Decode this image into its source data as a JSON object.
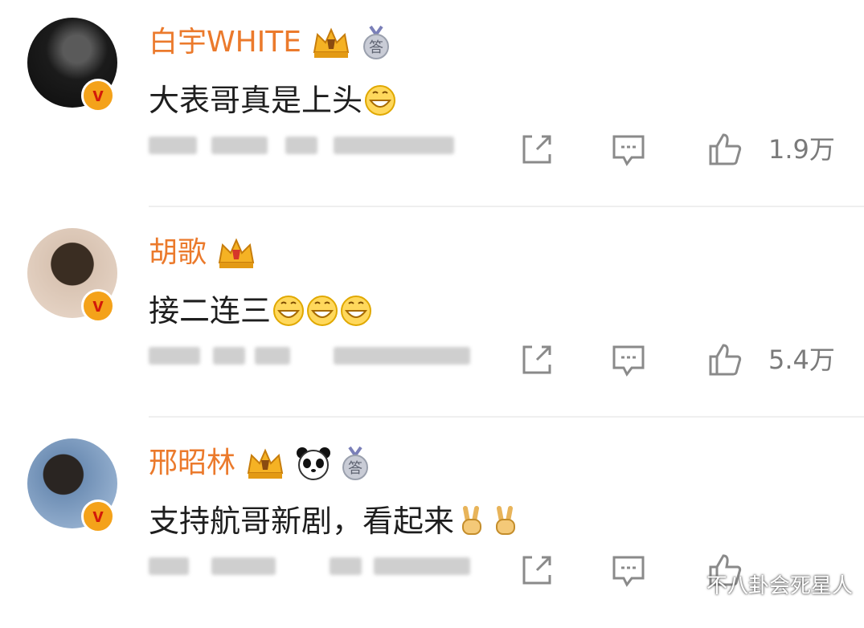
{
  "comments": [
    {
      "username": "白宇WHITE",
      "text": "大表哥真是上头",
      "emojis": [
        "grin-emoji"
      ],
      "badges": [
        "crown-badge-icon",
        "medal-answer-icon"
      ],
      "medal_char": "答",
      "likes": "1.9万",
      "verified_mark": "v"
    },
    {
      "username": "胡歌",
      "text": "接二连三",
      "emojis": [
        "grin-emoji",
        "grin-emoji",
        "grin-emoji"
      ],
      "badges": [
        "crown-badge-icon"
      ],
      "likes": "5.4万",
      "verified_mark": "v"
    },
    {
      "username": "邢昭林",
      "text": "支持航哥新剧，看起来",
      "emojis": [
        "victory-hand-emoji",
        "victory-hand-emoji"
      ],
      "badges": [
        "crown-badge-icon",
        "panda-icon",
        "medal-answer-icon"
      ],
      "medal_char": "答",
      "likes": "",
      "verified_mark": "v"
    }
  ],
  "watermark": "不八卦会死星人",
  "colors": {
    "username": "#eb7a2c",
    "verified_badge": "#f4a21a",
    "icon_gray": "#8a8a8a"
  }
}
